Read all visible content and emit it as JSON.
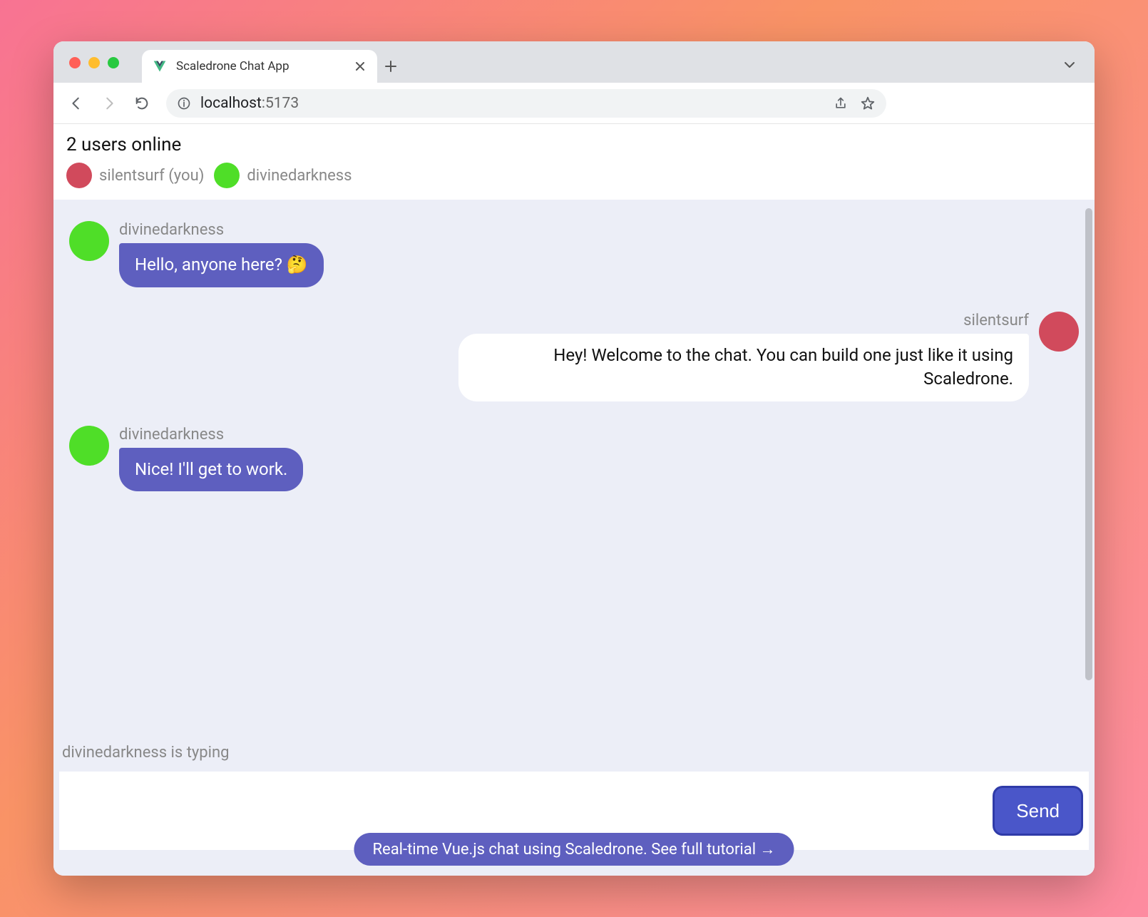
{
  "browser": {
    "tab_title": "Scaledrone Chat App",
    "url_host": "localhost",
    "url_port": ":5173"
  },
  "header": {
    "online_count_label": "2 users online",
    "users": [
      {
        "name": "silentsurf (you)",
        "color": "#d14a5c"
      },
      {
        "name": "divinedarkness",
        "color": "#4fde28"
      }
    ]
  },
  "messages": [
    {
      "author": "divinedarkness",
      "color": "#4fde28",
      "text": "Hello, anyone here? 🤔",
      "mine": false
    },
    {
      "author": "silentsurf",
      "color": "#d14a5c",
      "text": "Hey! Welcome to the chat. You can build one just like it using Scaledrone.",
      "mine": true
    },
    {
      "author": "divinedarkness",
      "color": "#4fde28",
      "text": "Nice! I'll get to work.",
      "mine": false
    }
  ],
  "typing_indicator": "divinedarkness is typing",
  "composer": {
    "input_value": "",
    "placeholder": "",
    "send_label": "Send"
  },
  "tutorial_link": "Real-time Vue.js chat using Scaledrone. See full tutorial →"
}
